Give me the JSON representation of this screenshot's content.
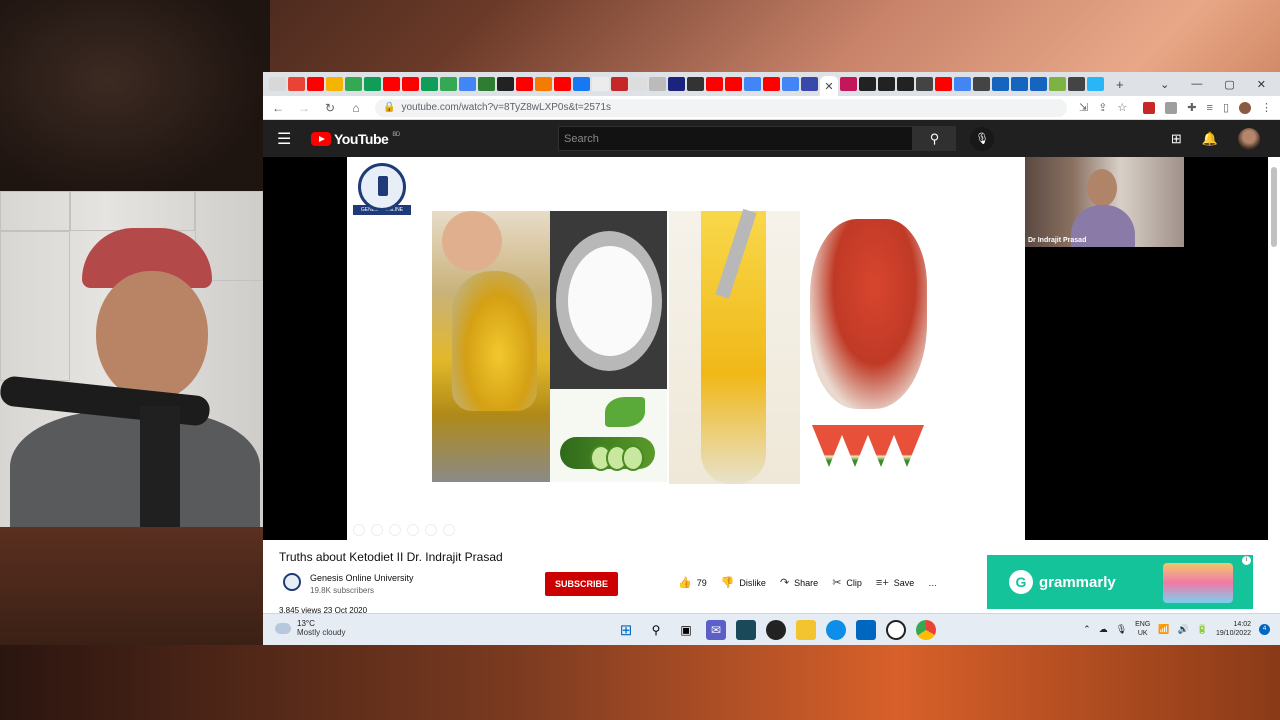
{
  "browser": {
    "url": "youtube.com/watch?v=8TyZ8wLXP0s&t=2571s",
    "active_tab_close": "✕",
    "new_tab": "+",
    "win_controls": [
      "⌄",
      "—",
      "▢",
      "✕"
    ]
  },
  "youtube": {
    "logo_text": "YouTube",
    "country_code": "BD",
    "search_placeholder": "Search"
  },
  "video": {
    "title": "Truths about Ketodiet II Dr. Indrajit Prasad",
    "channel": "Genesis Online University",
    "subscribers": "19.8K subscribers",
    "subscribe_label": "SUBSCRIBE",
    "like_count": "79",
    "dislike_label": "Dislike",
    "share_label": "Share",
    "clip_label": "Clip",
    "save_label": "Save",
    "more_label": "…",
    "views_date": "3,845 views  23 Oct 2020"
  },
  "slide": {
    "logo_ribbon": "GENESIS ONLINE UNIVERSITY"
  },
  "participant": {
    "name": "Dr Indrajit Prasad"
  },
  "ad": {
    "brand": "grammarly",
    "info": "i"
  },
  "taskbar": {
    "temp": "13°C",
    "condition": "Mostly cloudy",
    "lang_top": "ENG",
    "lang_bottom": "UK",
    "time": "14:02",
    "date": "19/10/2022",
    "notifications": "4"
  }
}
